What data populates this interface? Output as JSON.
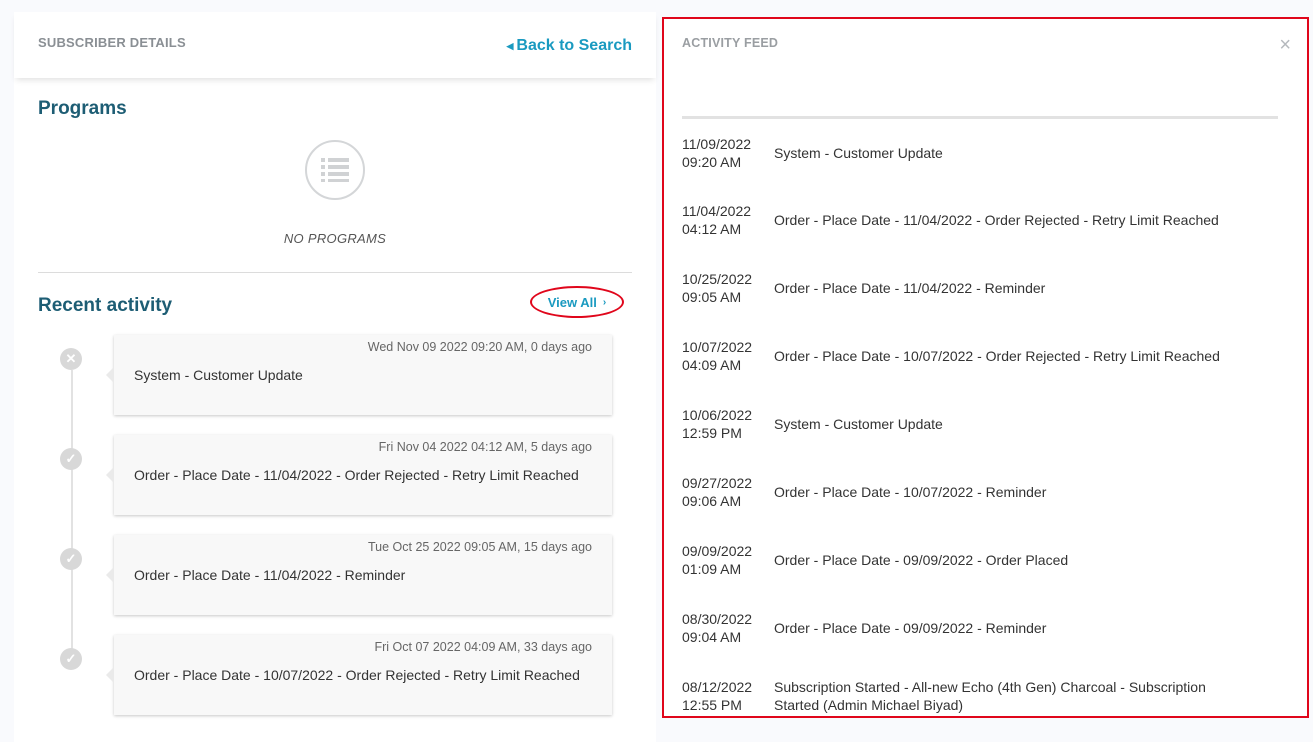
{
  "left": {
    "header_title": "SUBSCRIBER DETAILS",
    "back_link": "Back to Search",
    "programs_title": "Programs",
    "no_programs": "NO PROGRAMS",
    "recent_title": "Recent activity",
    "view_all": "View All",
    "activities": [
      {
        "time": "Wed Nov 09 2022 09:20 AM, 0 days ago",
        "text": "System - Customer Update",
        "status": "x"
      },
      {
        "time": "Fri Nov 04 2022 04:12 AM, 5 days ago",
        "text": "Order - Place Date - 11/04/2022 - Order Rejected - Retry Limit Reached",
        "status": "check"
      },
      {
        "time": "Tue Oct 25 2022 09:05 AM, 15 days ago",
        "text": "Order - Place Date - 11/04/2022 - Reminder",
        "status": "check"
      },
      {
        "time": "Fri Oct 07 2022 04:09 AM, 33 days ago",
        "text": "Order - Place Date - 10/07/2022 - Order Rejected - Retry Limit Reached",
        "status": "check"
      }
    ]
  },
  "feed": {
    "title": "ACTIVITY FEED",
    "close": "×",
    "items": [
      {
        "date": "11/09/2022",
        "time": "09:20 AM",
        "text": "System - Customer Update"
      },
      {
        "date": "11/04/2022",
        "time": "04:12 AM",
        "text": "Order - Place Date - 11/04/2022 - Order Rejected - Retry Limit Reached"
      },
      {
        "date": "10/25/2022",
        "time": "09:05 AM",
        "text": "Order - Place Date - 11/04/2022 - Reminder"
      },
      {
        "date": "10/07/2022",
        "time": "04:09 AM",
        "text": "Order - Place Date - 10/07/2022 - Order Rejected - Retry Limit Reached"
      },
      {
        "date": "10/06/2022",
        "time": "12:59 PM",
        "text": "System - Customer Update"
      },
      {
        "date": "09/27/2022",
        "time": "09:06 AM",
        "text": "Order - Place Date - 10/07/2022 - Reminder"
      },
      {
        "date": "09/09/2022",
        "time": "01:09 AM",
        "text": "Order - Place Date - 09/09/2022 - Order Placed"
      },
      {
        "date": "08/30/2022",
        "time": "09:04 AM",
        "text": "Order - Place Date - 09/09/2022 - Reminder"
      },
      {
        "date": "08/12/2022",
        "time": "12:55 PM",
        "text": "Subscription Started - All-new Echo (4th Gen) Charcoal - Subscription Started (Admin Michael Biyad)"
      }
    ]
  },
  "colors": {
    "accent": "#1a9ac0",
    "heading": "#1d5d74",
    "highlight": "#e0061b"
  },
  "icons": {
    "programs": "list-icon",
    "back": "chevron-left-icon",
    "view_all": "chevron-right-icon",
    "close": "close-icon"
  }
}
